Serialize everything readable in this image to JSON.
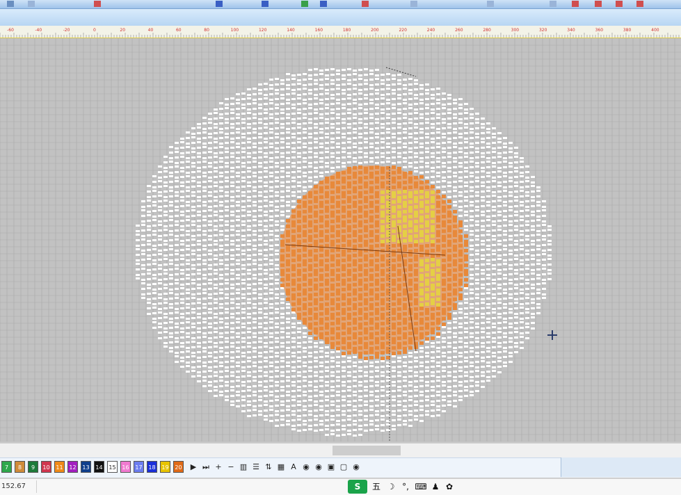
{
  "ruler": {
    "labels": [
      "-60",
      "-40",
      "-20",
      "0",
      "20",
      "40",
      "60",
      "80",
      "100",
      "120",
      "140",
      "160",
      "180",
      "200",
      "220",
      "240",
      "260",
      "280",
      "300",
      "320",
      "340",
      "360",
      "380",
      "400"
    ]
  },
  "canvas": {
    "background": "#c2c2c2",
    "grid_color": "#a9a9a9",
    "stitch_white": "#ffffff",
    "stitch_orange": "#e8893a",
    "stitch_orange_fill": "#e7a06a",
    "stitch_yellow": "#e5cf45"
  },
  "palette": {
    "swatches": [
      {
        "label": "7",
        "color": "#2ea84c"
      },
      {
        "label": "8",
        "color": "#d08c3a"
      },
      {
        "label": "9",
        "color": "#1d7a3a"
      },
      {
        "label": "10",
        "color": "#d0364f"
      },
      {
        "label": "11",
        "color": "#f08a18"
      },
      {
        "label": "12",
        "color": "#a21ec0"
      },
      {
        "label": "13",
        "color": "#0f3f8c"
      },
      {
        "label": "14",
        "color": "#111111"
      },
      {
        "label": "15",
        "color": "#ffffff"
      },
      {
        "label": "16",
        "color": "#f07ad0"
      },
      {
        "label": "17",
        "color": "#6b7df0"
      },
      {
        "label": "18",
        "color": "#1a2fd9"
      },
      {
        "label": "19",
        "color": "#e8c400"
      },
      {
        "label": "20",
        "color": "#e06a18"
      }
    ],
    "tools": [
      {
        "name": "play-button",
        "glyph": "▶"
      },
      {
        "name": "step-button",
        "glyph": "⏭"
      },
      {
        "name": "zoom-in-button",
        "glyph": "+"
      },
      {
        "name": "zoom-out-button",
        "glyph": "−"
      },
      {
        "name": "bars-button",
        "glyph": "▥"
      },
      {
        "name": "list-button",
        "glyph": "☰"
      },
      {
        "name": "sort-button",
        "glyph": "⇅"
      },
      {
        "name": "grid-button",
        "glyph": "▦"
      },
      {
        "name": "text-button",
        "glyph": "A"
      },
      {
        "name": "eye-button",
        "glyph": "◉"
      },
      {
        "name": "eye-filter-button",
        "glyph": "◉"
      },
      {
        "name": "image-button",
        "glyph": "▣"
      },
      {
        "name": "image-hide-button",
        "glyph": "▢"
      },
      {
        "name": "eye-alt-button",
        "glyph": "◉"
      }
    ]
  },
  "status": {
    "coordinate": "152.67"
  },
  "ime": {
    "logo": "S",
    "mode": "五",
    "moon": "☽",
    "punct": "°,",
    "keyboard": "⌨",
    "user": "♟",
    "settings": "✿"
  }
}
